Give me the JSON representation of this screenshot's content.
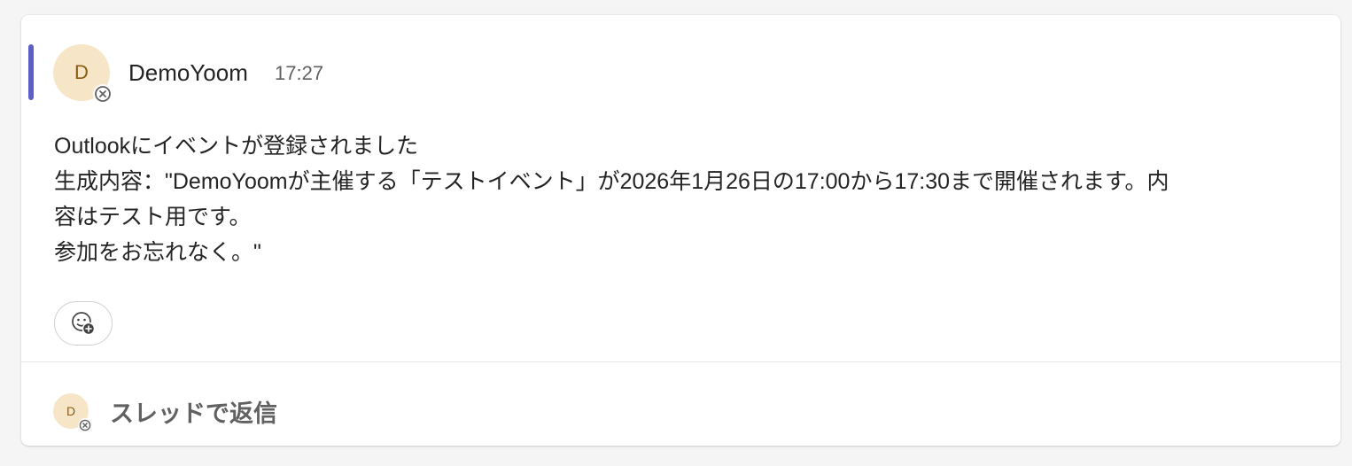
{
  "colors": {
    "accent": "#5b5fc7",
    "avatar_bg": "#f6e6c7",
    "avatar_text": "#8a5a14",
    "presence": "#616161"
  },
  "message": {
    "author_initial": "D",
    "author": "DemoYoom",
    "time": "17:27",
    "lines": [
      "Outlookにイベントが登録されました",
      "生成内容：\"DemoYoomが主催する「テストイベント」が2026年1月26日の17:00から17:30まで開催されます。内",
      "容はテスト用です。",
      "参加をお忘れなく。\""
    ],
    "reaction_icon": "add-reaction-icon"
  },
  "reply": {
    "avatar_initial": "D",
    "label": "スレッドで返信"
  }
}
